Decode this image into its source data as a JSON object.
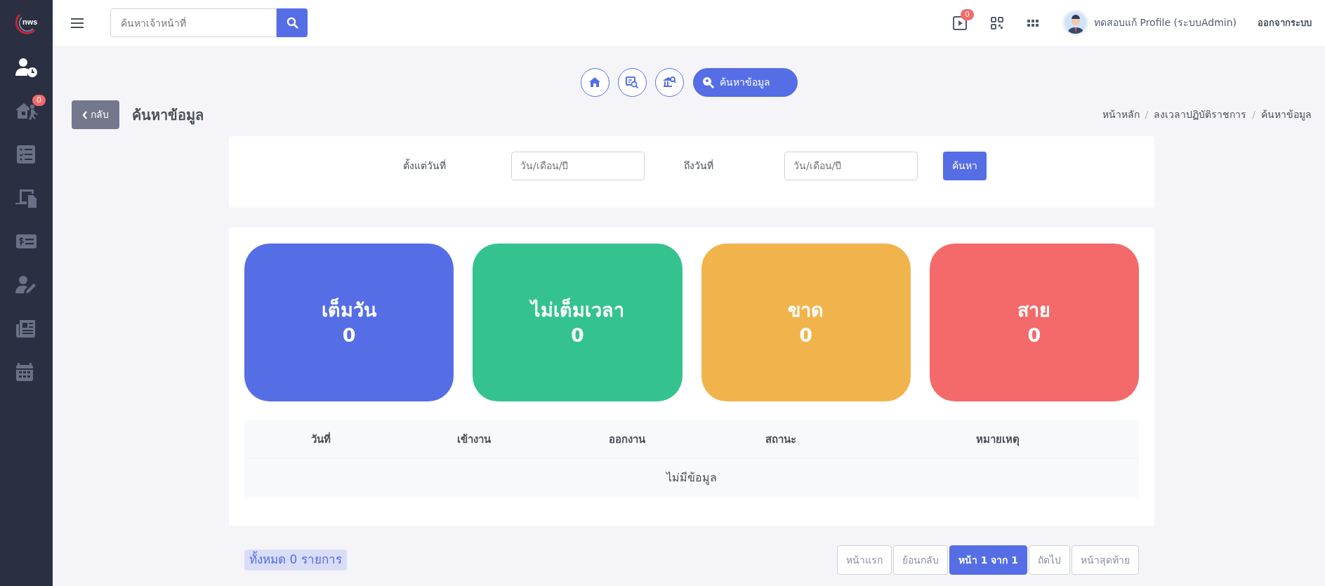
{
  "sidebar": {
    "logo": "nws",
    "items": [
      {
        "selected": true
      },
      {
        "selected": false,
        "badge": "0"
      },
      {
        "selected": false
      },
      {
        "selected": false
      },
      {
        "selected": false
      },
      {
        "selected": false
      },
      {
        "selected": false
      },
      {
        "selected": false
      }
    ]
  },
  "topbar": {
    "search": {
      "placeholder": "ค้นหาเจ้าหน้าที่"
    },
    "video_badge": "0",
    "user_name": "ทดสอบแก้ Profile (ระบบAdmin)",
    "logout": "ออกจากระบบ"
  },
  "shortcuts": [
    {
      "selected": false
    },
    {
      "selected": false
    },
    {
      "selected": false
    },
    {
      "label": "ค้นหาข้อมูล",
      "selected": true
    }
  ],
  "page": {
    "back": "กลับ",
    "title": "ค้นหาข้อมูล",
    "breadcrumb": [
      "หน้าหลัก",
      "ลงเวลาปฏิบัติราชการ",
      "ค้นหาข้อมูล"
    ],
    "breadcrumb_separator": "/"
  },
  "filter": {
    "from_label": "ตั้งแต่วันที่",
    "from_placeholder": "วัน/เดือน/ปี",
    "to_label": "ถึงวันที่",
    "to_placeholder": "วัน/เดือน/ปี",
    "button": "ค้นหา"
  },
  "stats": [
    {
      "label": "เต็มวัน",
      "value": "0",
      "color": "#556ee6"
    },
    {
      "label": "ไม่เต็มเวลา",
      "value": "0",
      "color": "#34c38f"
    },
    {
      "label": "ขาด",
      "value": "0",
      "color": "#f1b44c"
    },
    {
      "label": "สาย",
      "value": "0",
      "color": "#f46a6a"
    }
  ],
  "table": {
    "columns": [
      "วันที่",
      "เข้างาน",
      "ออกงาน",
      "สถานะ",
      "หมายเหตุ"
    ],
    "empty": "ไม่มีข้อมูล"
  },
  "footer": {
    "total": "ทั้งหมด 0 รายการ",
    "pagination": [
      {
        "label": "หน้าแรก",
        "selected": false,
        "disabled": true
      },
      {
        "label": "ย้อนกลับ",
        "selected": false,
        "disabled": true
      },
      {
        "label": "หน้า 1 จาก 1",
        "selected": true,
        "disabled": false
      },
      {
        "label": "ถัดไป",
        "selected": false,
        "disabled": true
      },
      {
        "label": "หน้าสุดท้าย",
        "selected": false,
        "disabled": true
      }
    ]
  }
}
